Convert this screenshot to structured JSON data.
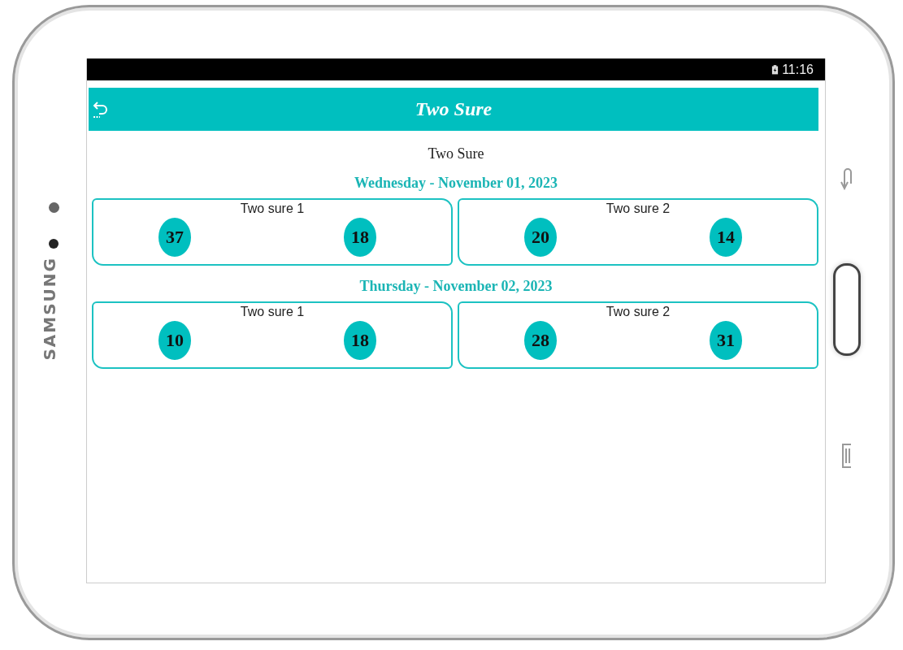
{
  "device": {
    "brand": "SAMSUNG"
  },
  "status_bar": {
    "time": "11:16"
  },
  "app_bar": {
    "title": "Two Sure"
  },
  "subtitle": "Two Sure",
  "days": [
    {
      "date": "Wednesday - November 01, 2023",
      "cards": [
        {
          "title": "Two sure 1",
          "numbers": [
            "37",
            "18"
          ]
        },
        {
          "title": "Two sure 2",
          "numbers": [
            "20",
            "14"
          ]
        }
      ]
    },
    {
      "date": "Thursday - November 02, 2023",
      "cards": [
        {
          "title": "Two sure 1",
          "numbers": [
            "10",
            "18"
          ]
        },
        {
          "title": "Two sure 2",
          "numbers": [
            "28",
            "31"
          ]
        }
      ]
    }
  ]
}
